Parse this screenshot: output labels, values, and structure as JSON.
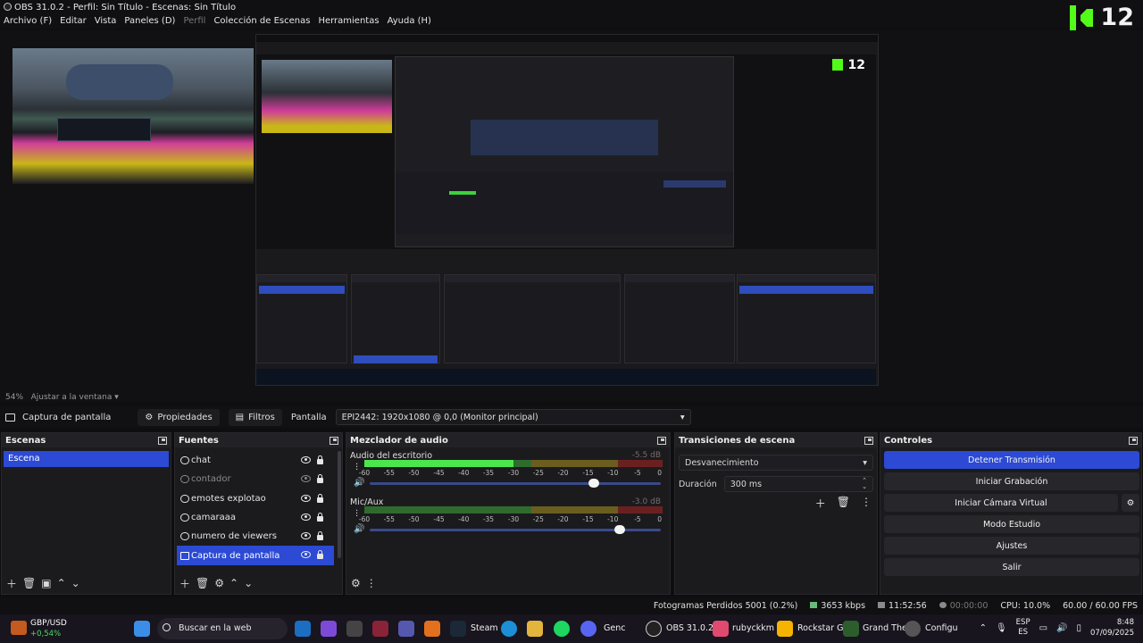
{
  "window": {
    "title": "OBS 31.0.2 - Perfil: Sin Título - Escenas: Sin Título"
  },
  "menu": [
    "Archivo (F)",
    "Editar",
    "Vista",
    "Paneles (D)",
    "Perfil",
    "Colección de Escenas",
    "Herramientas",
    "Ayuda (H)"
  ],
  "kick": {
    "viewers": "12"
  },
  "preview": {
    "zoom_label": "54%",
    "fit_label": "Ajustar a la ventana"
  },
  "source_toolbar": {
    "selected_source": "Captura de pantalla",
    "properties": "Propiedades",
    "filters": "Filtros",
    "screen_label": "Pantalla",
    "screen_value": "EPI2442: 1920x1080 @ 0,0 (Monitor principal)"
  },
  "scenes": {
    "title": "Escenas",
    "items": [
      "Escena"
    ]
  },
  "sources": {
    "title": "Fuentes",
    "items": [
      {
        "name": "chat",
        "visible": true
      },
      {
        "name": "contador",
        "visible": false
      },
      {
        "name": "emotes explotao",
        "visible": true
      },
      {
        "name": "camaraaa",
        "visible": true
      },
      {
        "name": "numero de viewers",
        "visible": true
      },
      {
        "name": "Captura de pantalla",
        "visible": true
      }
    ]
  },
  "mixer": {
    "title": "Mezclador de audio",
    "ticks": [
      "-60",
      "-55",
      "-50",
      "-45",
      "-40",
      "-35",
      "-30",
      "-25",
      "-20",
      "-15",
      "-10",
      "-5",
      "0"
    ],
    "channels": [
      {
        "name": "Audio del escritorio",
        "db": "-5.5 dB",
        "level": 0.5,
        "volume": 0.77
      },
      {
        "name": "Mic/Aux",
        "db": "-3.0 dB",
        "level": 0.0,
        "volume": 0.86
      }
    ]
  },
  "transitions": {
    "title": "Transiciones de escena",
    "selected": "Desvanecimiento",
    "duration_label": "Duración",
    "duration_value": "300 ms"
  },
  "controls": {
    "title": "Controles",
    "stop_stream": "Detener Transmisión",
    "start_recording": "Iniciar Grabación",
    "start_virtual_cam": "Iniciar Cámara Virtual",
    "studio_mode": "Modo Estudio",
    "settings": "Ajustes",
    "exit": "Salir"
  },
  "status": {
    "dropped_frames": "Fotogramas Perdidos 5001 (0.2%)",
    "bitrate": "3653 kbps",
    "stream_time": "11:52:56",
    "rec_time": "00:00:00",
    "cpu": "CPU: 10.0%",
    "fps": "60.00 / 60.00 FPS"
  },
  "taskbar": {
    "weather_symbol": "GBP/USD",
    "weather_change": "+0,54%",
    "search_placeholder": "Buscar en la web",
    "apps": [
      "Steam",
      "Genc",
      "OBS 31.0.2",
      "rubyckkm",
      "Rockstar G",
      "Grand The",
      "Configu"
    ],
    "lang_top": "ESP",
    "lang_bottom": "ES",
    "time": "8:48",
    "date": "07/09/2025"
  },
  "colors": {
    "accent": "#2c4ad4",
    "kick_green": "#53fc18",
    "meter_green": "#4ce64c"
  }
}
